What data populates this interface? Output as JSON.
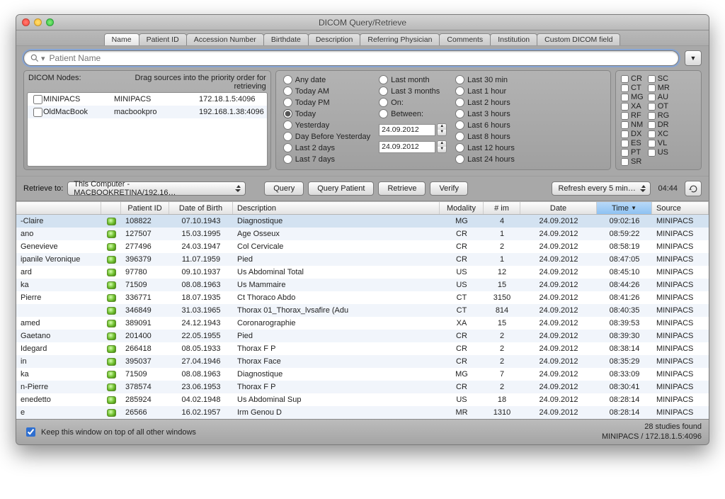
{
  "window": {
    "title": "DICOM Query/Retrieve"
  },
  "tabs": [
    "Name",
    "Patient ID",
    "Accession Number",
    "Birthdate",
    "Description",
    "Referring Physician",
    "Comments",
    "Institution",
    "Custom DICOM field"
  ],
  "tabs_active_index": 0,
  "search": {
    "placeholder": "Patient Name",
    "value": ""
  },
  "nodes": {
    "header_left": "DICOM Nodes:",
    "header_right": "Drag sources into the priority order for retrieving",
    "rows": [
      {
        "name": "MINIPACS",
        "aet": "MINIPACS",
        "addr": "172.18.1.5:4096"
      },
      {
        "name": "OldMacBook",
        "aet": "macbookpro",
        "addr": "192.168.1.38:4096"
      }
    ]
  },
  "date_filters": {
    "col1": [
      "Any date",
      "Today AM",
      "Today PM",
      "Today",
      "Yesterday",
      "Day Before Yesterday",
      "Last 2 days",
      "Last 7 days"
    ],
    "col2": [
      "Last month",
      "Last 3 months",
      "On:",
      "Between:"
    ],
    "col3": [
      "Last 30 min",
      "Last 1 hour",
      "Last 2 hours",
      "Last 3 hours",
      "Last 6 hours",
      "Last 8 hours",
      "Last 12 hours",
      "Last 24 hours"
    ],
    "selected": "Today",
    "from": "24.09.2012",
    "to": "24.09.2012"
  },
  "modalities": {
    "col1": [
      "CR",
      "CT",
      "MG",
      "XA",
      "RF",
      "NM",
      "DX",
      "ES",
      "PT",
      "SR"
    ],
    "col2": [
      "SC",
      "MR",
      "AU",
      "OT",
      "RG",
      "DR",
      "XC",
      "VL",
      "US"
    ]
  },
  "actions": {
    "retrieve_label": "Retrieve to:",
    "retrieve_target": "This Computer - MACBOOKRETINA/192.16…",
    "query": "Query",
    "query_patient": "Query Patient",
    "retrieve": "Retrieve",
    "verify": "Verify",
    "refresh": "Refresh every 5 min…",
    "clock": "04:44"
  },
  "columns": [
    "",
    "",
    "Patient ID",
    "Date of Birth",
    "Description",
    "Modality",
    "# im",
    "Date",
    "Time",
    "Source"
  ],
  "sort_column": "Time",
  "rows": [
    {
      "name": "-Claire",
      "pid": "108822",
      "dob": "07.10.1943",
      "desc": "Diagnostique",
      "mod": "MG",
      "im": "4",
      "date": "24.09.2012",
      "time": "09:02:16",
      "src": "MINIPACS",
      "selected": true
    },
    {
      "name": "ano",
      "pid": "127507",
      "dob": "15.03.1995",
      "desc": "Age Osseux",
      "mod": "CR",
      "im": "1",
      "date": "24.09.2012",
      "time": "08:59:22",
      "src": "MINIPACS"
    },
    {
      "name": "Genevieve",
      "pid": "277496",
      "dob": "24.03.1947",
      "desc": "Col Cervicale",
      "mod": "CR",
      "im": "2",
      "date": "24.09.2012",
      "time": "08:58:19",
      "src": "MINIPACS"
    },
    {
      "name": "ipanile Veronique",
      "pid": "396379",
      "dob": "11.07.1959",
      "desc": "Pied",
      "mod": "CR",
      "im": "1",
      "date": "24.09.2012",
      "time": "08:47:05",
      "src": "MINIPACS"
    },
    {
      "name": "ard",
      "pid": "97780",
      "dob": "09.10.1937",
      "desc": "Us Abdominal Total",
      "mod": "US",
      "im": "12",
      "date": "24.09.2012",
      "time": "08:45:10",
      "src": "MINIPACS"
    },
    {
      "name": "ka",
      "pid": "71509",
      "dob": "08.08.1963",
      "desc": "Us Mammaire",
      "mod": "US",
      "im": "15",
      "date": "24.09.2012",
      "time": "08:44:26",
      "src": "MINIPACS"
    },
    {
      "name": " Pierre",
      "pid": "336771",
      "dob": "18.07.1935",
      "desc": "Ct Thoraco Abdo",
      "mod": "CT",
      "im": "3150",
      "date": "24.09.2012",
      "time": "08:41:26",
      "src": "MINIPACS"
    },
    {
      "name": "",
      "pid": "346849",
      "dob": "31.03.1965",
      "desc": "Thorax 01_Thorax_lvsafire (Adu",
      "mod": "CT",
      "im": "814",
      "date": "24.09.2012",
      "time": "08:40:35",
      "src": "MINIPACS"
    },
    {
      "name": "amed",
      "pid": "389091",
      "dob": "24.12.1943",
      "desc": "Coronarographie",
      "mod": "XA",
      "im": "15",
      "date": "24.09.2012",
      "time": "08:39:53",
      "src": "MINIPACS"
    },
    {
      "name": "Gaetano",
      "pid": "201400",
      "dob": "22.05.1955",
      "desc": "Pied",
      "mod": "CR",
      "im": "2",
      "date": "24.09.2012",
      "time": "08:39:30",
      "src": "MINIPACS"
    },
    {
      "name": "Idegard",
      "pid": "266418",
      "dob": "08.05.1933",
      "desc": "Thorax F P",
      "mod": "CR",
      "im": "2",
      "date": "24.09.2012",
      "time": "08:38:14",
      "src": "MINIPACS"
    },
    {
      "name": "in",
      "pid": "395037",
      "dob": "27.04.1946",
      "desc": "Thorax Face",
      "mod": "CR",
      "im": "2",
      "date": "24.09.2012",
      "time": "08:35:29",
      "src": "MINIPACS"
    },
    {
      "name": "ka",
      "pid": "71509",
      "dob": "08.08.1963",
      "desc": "Diagnostique",
      "mod": "MG",
      "im": "7",
      "date": "24.09.2012",
      "time": "08:33:09",
      "src": "MINIPACS"
    },
    {
      "name": "n-Pierre",
      "pid": "378574",
      "dob": "23.06.1953",
      "desc": "Thorax F P",
      "mod": "CR",
      "im": "2",
      "date": "24.09.2012",
      "time": "08:30:41",
      "src": "MINIPACS"
    },
    {
      "name": "enedetto",
      "pid": "285924",
      "dob": "04.02.1948",
      "desc": "Us Abdominal Sup",
      "mod": "US",
      "im": "18",
      "date": "24.09.2012",
      "time": "08:28:14",
      "src": "MINIPACS"
    },
    {
      "name": "e",
      "pid": "26566",
      "dob": "16.02.1957",
      "desc": "Irm Genou D",
      "mod": "MR",
      "im": "1310",
      "date": "24.09.2012",
      "time": "08:28:14",
      "src": "MINIPACS"
    }
  ],
  "footer": {
    "keep_on_top": "Keep this window on top of all other windows",
    "status_line1": "28 studies found",
    "status_line2": "MINIPACS  /  172.18.1.5:4096"
  }
}
